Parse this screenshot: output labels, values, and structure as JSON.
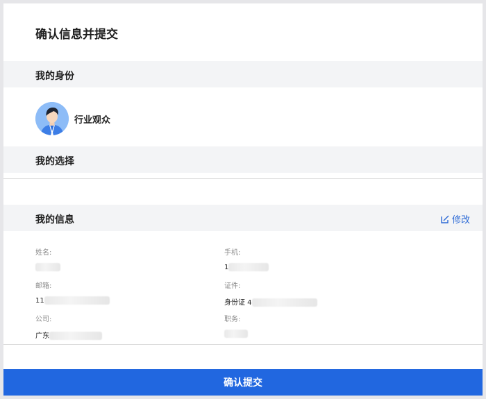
{
  "page": {
    "title": "确认信息并提交"
  },
  "identity": {
    "section_title": "我的身份",
    "role_label": "行业观众",
    "avatar_icon": "business-person-avatar"
  },
  "choice": {
    "section_title": "我的选择"
  },
  "info": {
    "section_title": "我的信息",
    "edit_label": "修改",
    "edit_icon": "edit-icon",
    "fields": {
      "name": {
        "label": "姓名:",
        "value_visible": ""
      },
      "phone": {
        "label": "手机:",
        "value_visible": "1"
      },
      "email": {
        "label": "邮箱:",
        "value_visible": "11"
      },
      "id_doc": {
        "label": "证件:",
        "value_visible": "身份证 4"
      },
      "company": {
        "label": "公司:",
        "value_visible": "广东"
      },
      "position": {
        "label": "职务:",
        "value_visible": ""
      }
    }
  },
  "submit": {
    "label": "确认提交"
  },
  "colors": {
    "accent": "#2167e0",
    "link": "#2d6ad6",
    "section_bg": "#f3f4f6"
  }
}
